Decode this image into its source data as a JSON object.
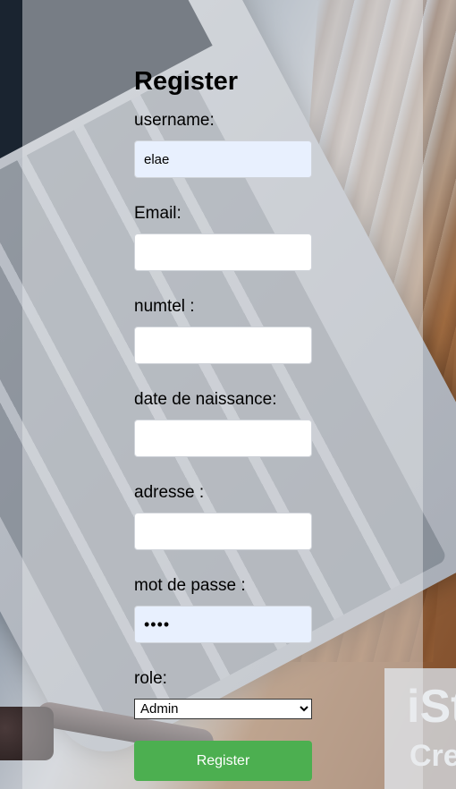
{
  "form": {
    "title": "Register",
    "fields": [
      {
        "label": "username:",
        "value": "elae",
        "type": "text"
      },
      {
        "label": "Email:",
        "value": "",
        "type": "email"
      },
      {
        "label": "numtel :",
        "value": "",
        "type": "tel"
      },
      {
        "label": "date de naissance:",
        "value": "",
        "type": "text"
      },
      {
        "label": "adresse :",
        "value": "",
        "type": "text"
      },
      {
        "label": "mot de passe :",
        "value": "••••",
        "type": "password"
      }
    ],
    "role": {
      "label": "role:",
      "selected": "Admin"
    },
    "submit_label": "Register"
  },
  "watermark": {
    "text": "iSt",
    "sub": "Cre"
  },
  "colors": {
    "button_bg": "#4caf50",
    "autofill_bg": "#e8f0fe"
  }
}
